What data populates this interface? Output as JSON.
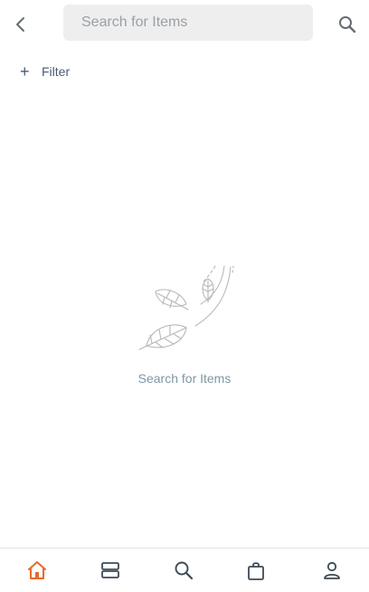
{
  "header": {
    "back_icon": "chevron-left-icon",
    "search_placeholder": "Search for Items",
    "search_value": "",
    "search_icon": "search-icon"
  },
  "filter": {
    "icon": "plus-icon",
    "label": "Filter"
  },
  "empty_state": {
    "illustration": "falling-leaves-illustration",
    "message": "Search for Items"
  },
  "bottom_nav": {
    "active_index": 0,
    "active_color": "#e8692a",
    "inactive_color": "#3d4a56",
    "items": [
      {
        "icon": "home-icon"
      },
      {
        "icon": "categories-icon"
      },
      {
        "icon": "search-icon"
      },
      {
        "icon": "shopping-bag-icon"
      },
      {
        "icon": "profile-icon"
      }
    ]
  }
}
